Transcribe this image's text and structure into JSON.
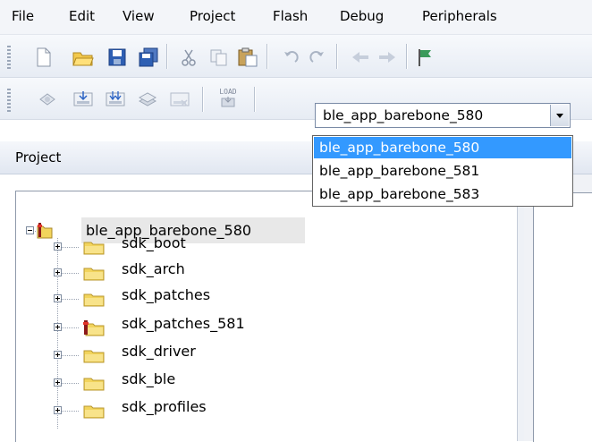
{
  "menu": [
    "File",
    "Edit",
    "View",
    "Project",
    "Flash",
    "Debug",
    "Peripherals"
  ],
  "toolbar1_icons": [
    "new-file-icon",
    "open-folder-icon",
    "save-icon",
    "save-all-icon",
    "cut-icon",
    "copy-icon",
    "paste-icon",
    "undo-icon",
    "redo-icon",
    "back-icon",
    "forward-icon",
    "bookmark-flag-icon"
  ],
  "toolbar2_icons": [
    "translate-icon",
    "build-icon",
    "rebuild-icon",
    "batch-build-icon",
    "stop-build-icon",
    "load-icon"
  ],
  "load_label": "LOAD",
  "target_select": {
    "value": "ble_app_barebone_580",
    "options": [
      "ble_app_barebone_580",
      "ble_app_barebone_581",
      "ble_app_barebone_583"
    ]
  },
  "project_panel": {
    "title": "Project",
    "root": "ble_app_barebone_580",
    "groups": [
      "sdk_boot",
      "sdk_arch",
      "sdk_patches",
      "sdk_patches_581",
      "sdk_driver",
      "sdk_ble",
      "sdk_profiles"
    ]
  },
  "colors": {
    "selection": "#3399ff",
    "folder": "#f2d45c",
    "folder_red": "#8b1a1a"
  }
}
